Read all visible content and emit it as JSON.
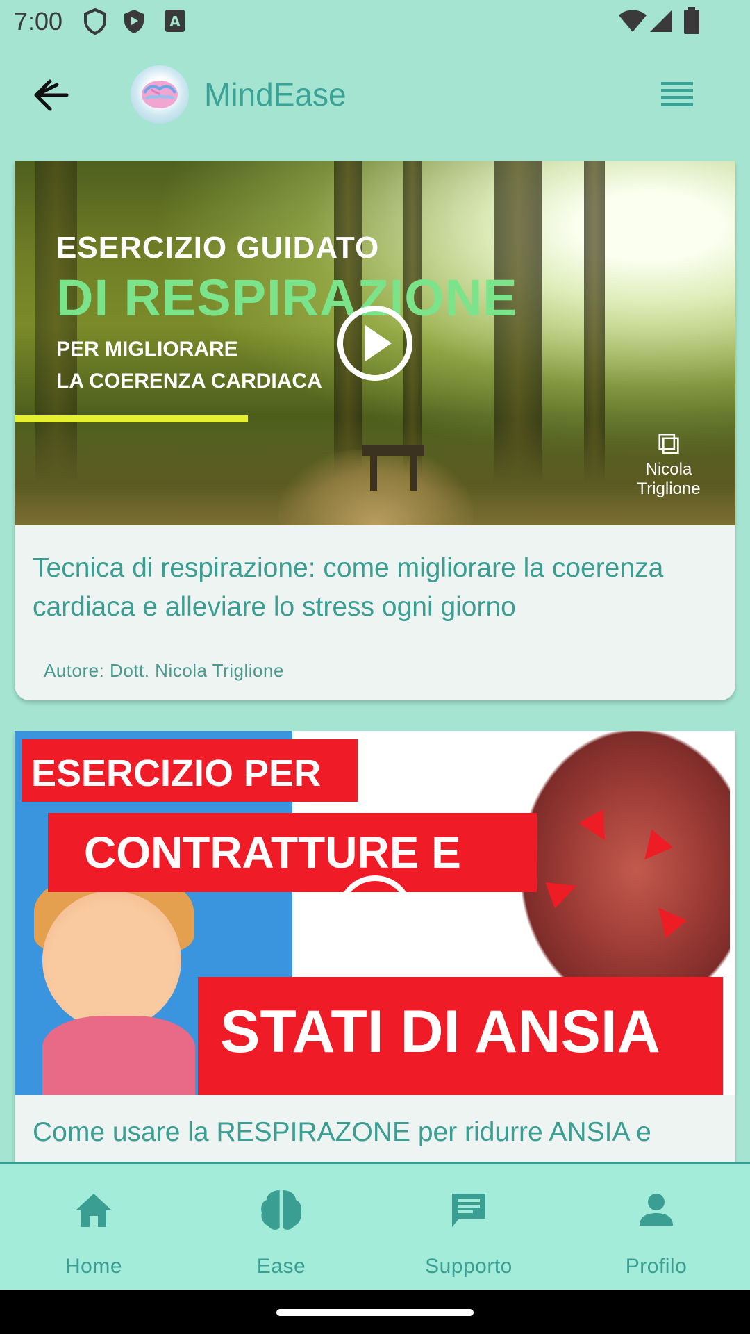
{
  "status_bar": {
    "time": "7:00",
    "icons": [
      "shield-icon",
      "play-protect-icon",
      "keyboard-a-icon",
      "wifi-icon",
      "signal-icon",
      "battery-icon"
    ]
  },
  "app_bar": {
    "title": "MindEase",
    "back_icon": "arrow-left-icon",
    "menu_icon": "list-menu-icon",
    "accent_color": "#3aa296"
  },
  "articles": [
    {
      "thumbnail_lines": [
        "ESERCIZIO GUIDATO",
        "DI RESPIRAZIONE",
        "PER MIGLIORARE",
        "LA COERENZA CARDIACA"
      ],
      "thumbnail_author": [
        "Nicola",
        "Triglione"
      ],
      "title": "Tecnica di respirazione: come migliorare la coerenza cardiaca e alleviare lo stress ogni giorno",
      "author": "Autore: Dott. Nicola Triglione"
    },
    {
      "thumbnail_lines": [
        "ESERCIZIO PER",
        "CONTRATTURE E",
        "STATI DI ANSIA"
      ],
      "title": "Come usare la RESPIRAZONE per ridurre ANSIA e"
    }
  ],
  "bottom_nav": [
    {
      "label": "Home",
      "icon": "home-icon"
    },
    {
      "label": "Ease",
      "icon": "brain-icon"
    },
    {
      "label": "Supporto",
      "icon": "chat-icon"
    },
    {
      "label": "Profilo",
      "icon": "person-icon"
    }
  ],
  "colors": {
    "background": "#a4e4d0",
    "card": "#eef4f2",
    "nav_bg": "#a4ecda",
    "primary_text": "#3a9e93"
  }
}
